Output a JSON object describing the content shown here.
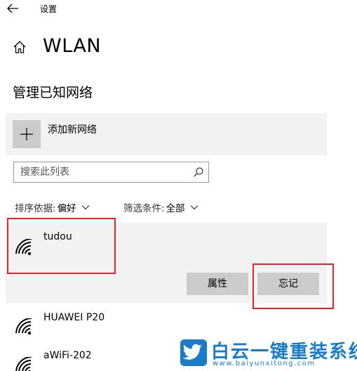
{
  "window": {
    "title": "设置"
  },
  "icons": {
    "back": "back-arrow-icon",
    "home": "home-icon",
    "add": "plus-icon",
    "search": "search-icon",
    "wifi": "wifi-signal-icon",
    "dropdown": "chevron-down-icon"
  },
  "page": {
    "title": "WLAN"
  },
  "section": {
    "title": "管理已知网络"
  },
  "add_network": {
    "label": "添加新网络"
  },
  "search": {
    "placeholder": "搜索此列表",
    "value": ""
  },
  "filters": {
    "sort": {
      "label": "排序依据:",
      "value": "偏好"
    },
    "type": {
      "label": "筛选条件:",
      "value": "全部"
    }
  },
  "networks": [
    {
      "name": "tudou",
      "selected": true,
      "buttons": {
        "properties": "属性",
        "forget": "忘记"
      }
    },
    {
      "name": "HUAWEI P20"
    },
    {
      "name": "aWiFi-202"
    }
  ],
  "colors": {
    "highlight": "#e0262a",
    "panel": "#f2f2f2",
    "button": "#cccccc",
    "watermark": "#1a7cc9"
  },
  "watermark": {
    "brand": "白云一键重装系统",
    "url": "www.baiyunxitong.com"
  }
}
